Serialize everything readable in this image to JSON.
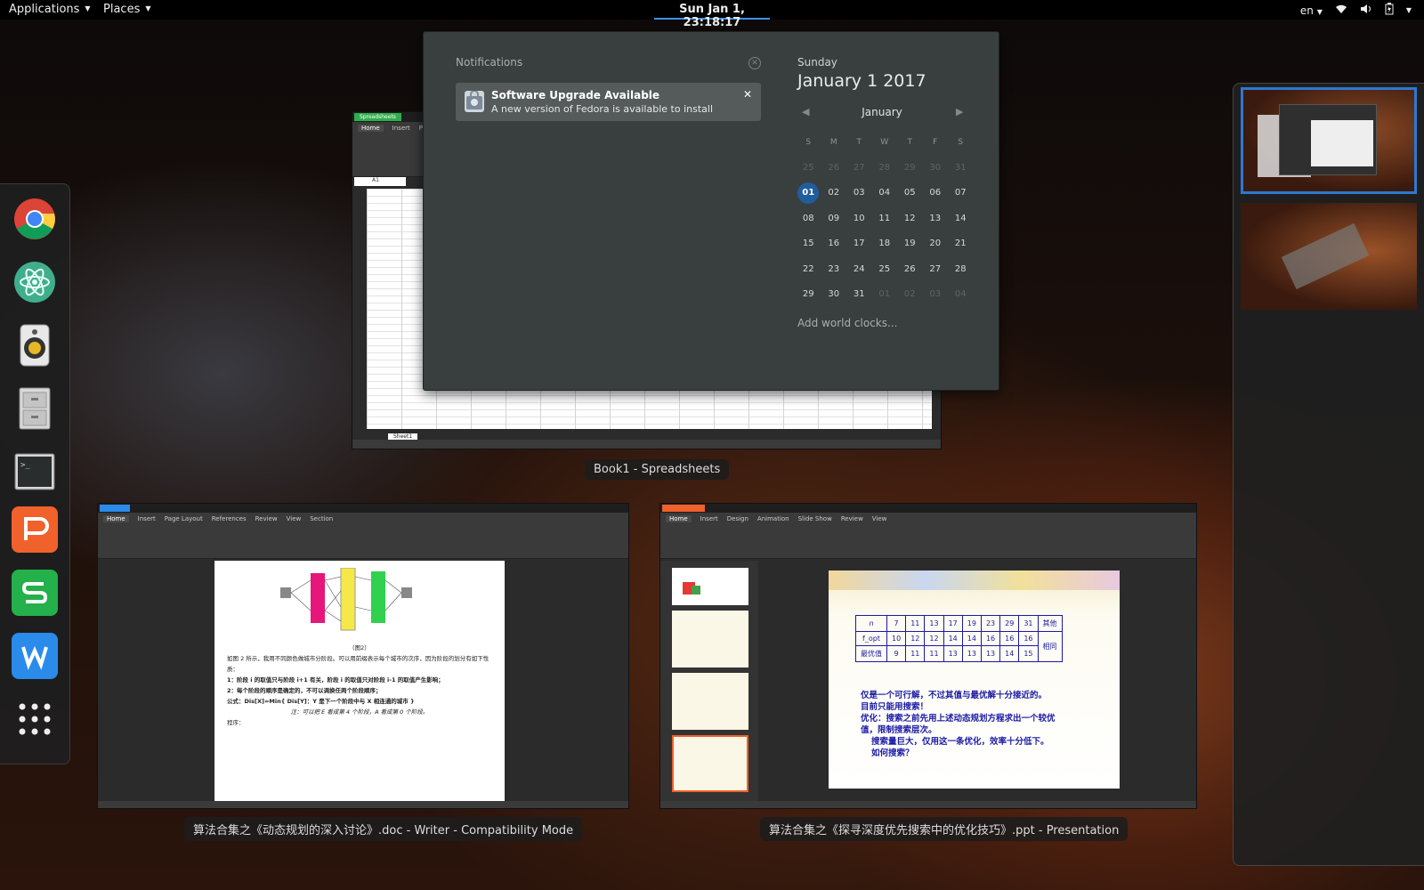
{
  "topbar": {
    "applications": "Applications",
    "places": "Places",
    "clock": "Sun Jan  1, 23:18:17",
    "lang": "en"
  },
  "dash": {
    "apps": [
      "chrome-icon",
      "atom-icon",
      "rhythmbox-icon",
      "files-icon",
      "terminal-icon",
      "wps-presentation-icon",
      "wps-spreadsheets-icon",
      "wps-writer-icon",
      "show-applications-icon"
    ]
  },
  "notifications": {
    "header": "Notifications",
    "items": [
      {
        "title": "Software Upgrade Available",
        "body": "A new version of Fedora is available to install"
      }
    ]
  },
  "calendar": {
    "weekday": "Sunday",
    "date": "January  1 2017",
    "month": "January",
    "weekdays": [
      "S",
      "M",
      "T",
      "W",
      "T",
      "F",
      "S"
    ],
    "weeks": [
      [
        "25",
        "26",
        "27",
        "28",
        "29",
        "30",
        "31"
      ],
      [
        "01",
        "02",
        "03",
        "04",
        "05",
        "06",
        "07"
      ],
      [
        "08",
        "09",
        "10",
        "11",
        "12",
        "13",
        "14"
      ],
      [
        "15",
        "16",
        "17",
        "18",
        "19",
        "20",
        "21"
      ],
      [
        "22",
        "23",
        "24",
        "25",
        "26",
        "27",
        "28"
      ],
      [
        "29",
        "30",
        "31",
        "01",
        "02",
        "03",
        "04"
      ]
    ],
    "today": "01",
    "world_clocks": "Add world clocks..."
  },
  "windows": {
    "spreadsheet": {
      "caption": "Book1 - Spreadsheets",
      "tab": "Spreadsheets",
      "ribbon_tabs": [
        "Home",
        "Insert",
        "Pag"
      ],
      "cell_ref": "A1",
      "sheet_tab": "Sheet1"
    },
    "writer": {
      "caption": "算法合集之《动态规划的深入讨论》.doc - Writer - Compatibility Mode",
      "ribbon_tabs": [
        "Home",
        "Insert",
        "Page Layout",
        "References",
        "Review",
        "View",
        "Section"
      ],
      "doc_lines": [
        "（图2）",
        "如图 2 所示，我用不同颜色做城市分阶段。可以用前缀表示每个城市的次序，因为阶段的划分有如下性质：",
        "1：阶段 i 的取值只与阶段 i+1 有关，阶段 i 的取值只对阶段 i-1 的取值产生影响；",
        "2：每个阶段的顺序是确定的，不可以调换任两个阶段顺序；",
        "公式：Dis[X]=Min{ Dis[Y]：Y 是下一个阶段中与 X 相连通的城市 }",
        "注：可以把 E 看成第 4 个阶段，A 看成第 0 个阶段。",
        "程序："
      ]
    },
    "presentation": {
      "caption": "算法合集之《探寻深度优先搜索中的优化技巧》.ppt - Presentation",
      "ribbon_tabs": [
        "Home",
        "Insert",
        "Design",
        "Animation",
        "Slide Show",
        "Review",
        "View"
      ],
      "table_header": [
        "n",
        "7",
        "11",
        "13",
        "17",
        "19",
        "23",
        "29",
        "31",
        "其他"
      ],
      "table_row2": [
        "f_opt",
        "10",
        "12",
        "12",
        "14",
        "14",
        "16",
        "16",
        "16"
      ],
      "table_row3": [
        "最优值",
        "9",
        "11",
        "11",
        "13",
        "13",
        "13",
        "14",
        "15"
      ],
      "row_merged": "相同",
      "slide_text": [
        "仅是一个可行解，不过其值与最优解十分接近的。",
        "目前只能用搜索！",
        "优化：搜索之前先用上述动态规划方程求出一个较优",
        "值，限制搜索层次。",
        "搜索量巨大，仅用这一条优化，效率十分低下。",
        "如何搜索？"
      ]
    }
  }
}
